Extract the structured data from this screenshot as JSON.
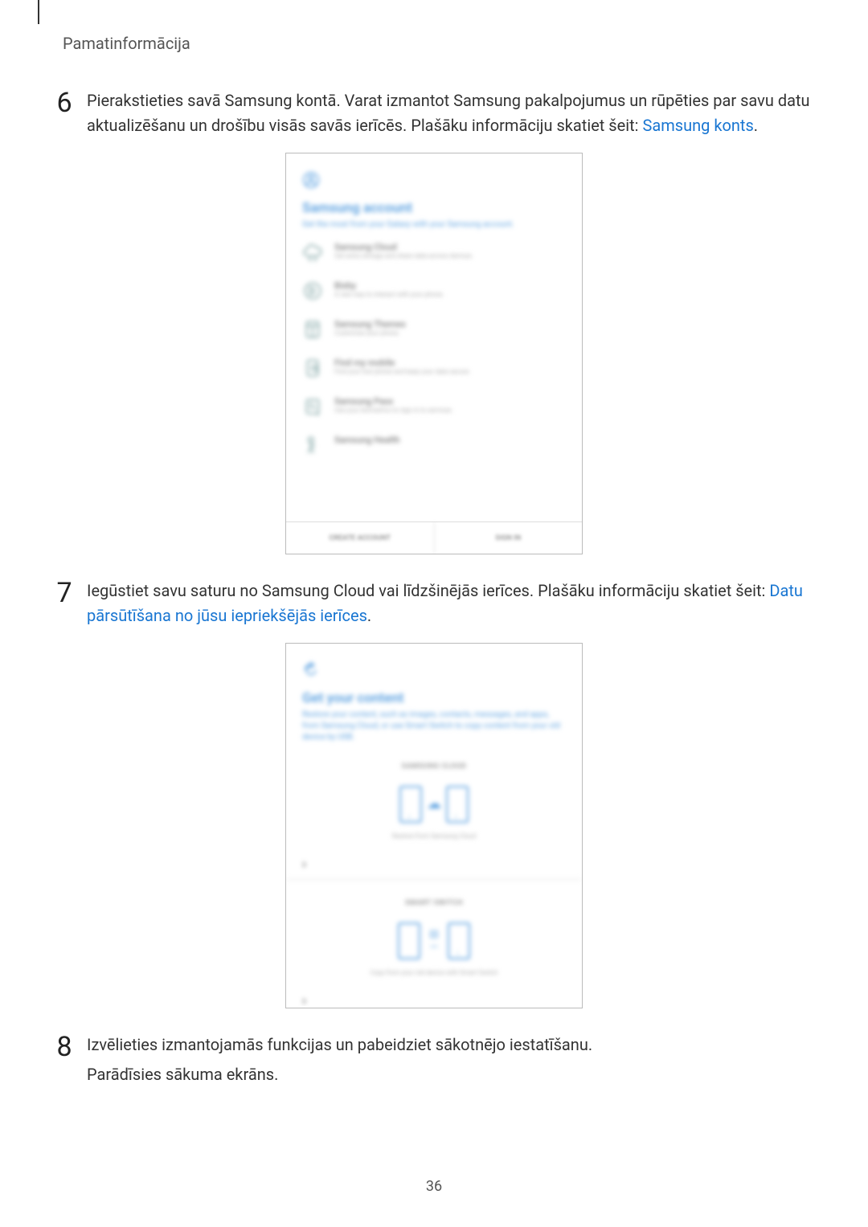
{
  "header": "Pamatinformācija",
  "page_number": "36",
  "steps": [
    {
      "num": "6",
      "text_before_link": "Pierakstieties savā Samsung kontā. Varat izmantot Samsung pakalpojumus un rūpēties par savu datu aktualizēšanu un drošību visās savās ierīcēs. Plašāku informāciju skatiet šeit: ",
      "link": "Samsung konts",
      "period": "."
    },
    {
      "num": "7",
      "text_before_link": "Iegūstiet savu saturu no Samsung Cloud vai līdzšinējās ierīces. Plašāku informāciju skatiet šeit: ",
      "link": "Datu pārsūtīšana no jūsu iepriekšējās ierīces",
      "period": "."
    },
    {
      "num": "8",
      "text1": "Izvēlieties izmantojamās funkcijas un pabeidziet sākotnējo iestatīšanu.",
      "text2": "Parādīsies sākuma ekrāns."
    }
  ],
  "shot1": {
    "title": "Samsung account",
    "subtitle": "Get the most from your Galaxy with your Samsung account.",
    "rows": [
      {
        "icon": "cloud-sync-icon",
        "title": "Samsung Cloud",
        "sub": "Get extra storage and share data across devices."
      },
      {
        "icon": "bixby-icon",
        "title": "Bixby",
        "sub": "A new way to interact with your phone."
      },
      {
        "icon": "themes-icon",
        "title": "Samsung Themes",
        "sub": "Customize your phone."
      },
      {
        "icon": "find-icon",
        "title": "Find my mobile",
        "sub": "Find your lost phone and keep your data secure."
      },
      {
        "icon": "pass-icon",
        "title": "Samsung Pass",
        "sub": "Use your biometrics to sign in to services."
      },
      {
        "icon": "health-icon",
        "title": "Samsung Health",
        "sub": ""
      }
    ],
    "footer_left": "CREATE ACCOUNT",
    "footer_right": "SIGN IN"
  },
  "shot2": {
    "title": "Get your content",
    "subtitle": "Restore your content, such as images, contacts, messages, and apps, from Samsung Cloud, or use Smart Switch to copy content from your old device by USB.",
    "opt1_label": "SAMSUNG CLOUD",
    "opt1_caption": "Restore from Samsung Cloud",
    "opt2_label": "SMART SWITCH",
    "opt2_caption": "Copy from your old device with Smart Switch"
  }
}
